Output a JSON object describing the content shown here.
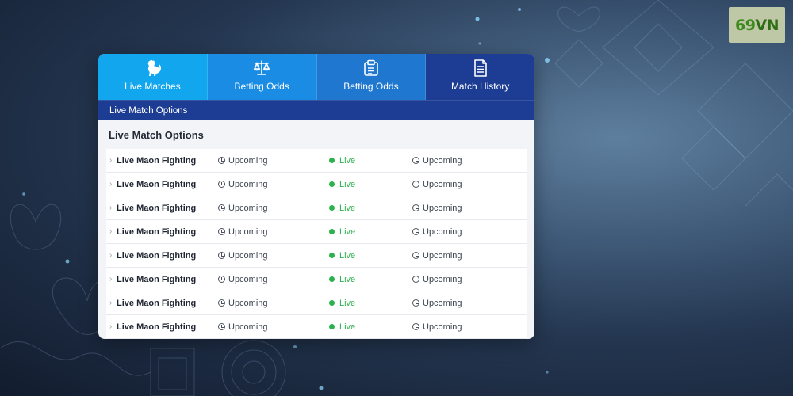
{
  "brand": {
    "logo_text": "69VN",
    "accent": "#3f8a1f"
  },
  "tabs": [
    {
      "label": "Live Matches",
      "icon": "rooster-icon",
      "color": "#12a6ee"
    },
    {
      "label": "Betting Odds",
      "icon": "scales-icon",
      "color": "#1b8ce3"
    },
    {
      "label": "Betting Odds",
      "icon": "clipboard-icon",
      "color": "#1f77cf"
    },
    {
      "label": "Match History",
      "icon": "document-icon",
      "color": "#1d3d94"
    }
  ],
  "subbar": {
    "label": "Live Match Options"
  },
  "section": {
    "title": "Live Match Options"
  },
  "status_colors": {
    "live": "#2bb24c"
  },
  "rows": [
    {
      "name": "Live Maon Fighting",
      "status1": "Upcoming",
      "status2": "Live",
      "status3": "Upcoming"
    },
    {
      "name": "Live Maon Fighting",
      "status1": "Upcoming",
      "status2": "Live",
      "status3": "Upcoming"
    },
    {
      "name": "Live Maon Fighting",
      "status1": "Upcoming",
      "status2": "Live",
      "status3": "Upcoming"
    },
    {
      "name": "Live Maon Fighting",
      "status1": "Upcoming",
      "status2": "Live",
      "status3": "Upcoming"
    },
    {
      "name": "Live Maon Fighting",
      "status1": "Upcoming",
      "status2": "Live",
      "status3": "Upcoming"
    },
    {
      "name": "Live Maon Fighting",
      "status1": "Upcoming",
      "status2": "Live",
      "status3": "Upcoming"
    },
    {
      "name": "Live Maon Fighting",
      "status1": "Upcoming",
      "status2": "Live",
      "status3": "Upcoming"
    },
    {
      "name": "Live Maon Fighting",
      "status1": "Upcoming",
      "status2": "Live",
      "status3": "Upcoming"
    }
  ]
}
